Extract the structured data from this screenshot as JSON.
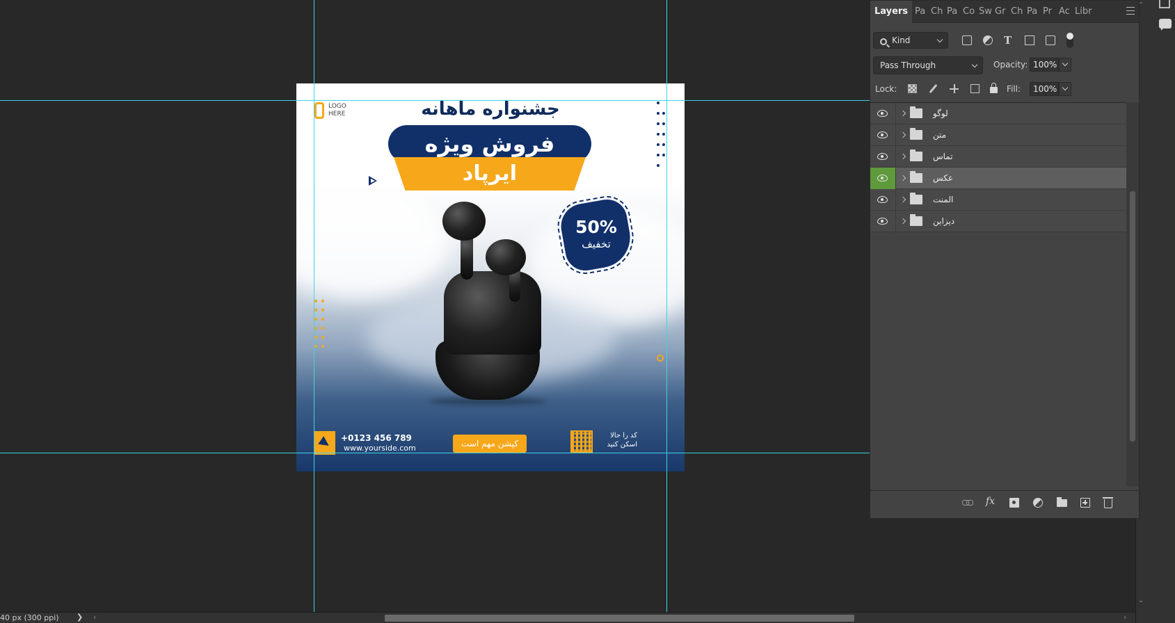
{
  "canvas": {
    "design": {
      "title_top": "جشنواره ماهانه",
      "banner_main": "فروش ویژه",
      "banner_product": "ایرپاد",
      "logo_text": "LOGO\nHERE",
      "discount_percent": "50%",
      "discount_label": "تخفیف",
      "phone": "+0123 456 789",
      "website": "www.yourside.com",
      "cta": "کپشن مهم است",
      "scan_line1": "کد را حالا",
      "scan_line2": "اسکن کنید",
      "colors": {
        "navy": "#11306a",
        "accent": "#f6a71a"
      }
    }
  },
  "status_bar": {
    "doc_info": "40 px (300 ppi)",
    "arrow": "❯"
  },
  "layers_panel": {
    "tabs": [
      {
        "label": "Layers",
        "active": true
      },
      {
        "label": "Pa"
      },
      {
        "label": "Ch"
      },
      {
        "label": "Pa"
      },
      {
        "label": "Co"
      },
      {
        "label": "Sw"
      },
      {
        "label": "Gr"
      },
      {
        "label": "Ch"
      },
      {
        "label": "Pa"
      },
      {
        "label": "Pr"
      },
      {
        "label": "Ac"
      },
      {
        "label": "Libr"
      }
    ],
    "filter": {
      "kind_label": "Kind"
    },
    "blend_mode": "Pass Through",
    "opacity_label": "Opacity:",
    "opacity_value": "100%",
    "lock_label": "Lock:",
    "fill_label": "Fill:",
    "fill_value": "100%",
    "layers": [
      {
        "name": "لوگو",
        "selected": false
      },
      {
        "name": "متن",
        "selected": false
      },
      {
        "name": "تماس",
        "selected": false
      },
      {
        "name": "عکس",
        "selected": true
      },
      {
        "name": "المنت",
        "selected": false
      },
      {
        "name": "دیزاین",
        "selected": false
      }
    ],
    "bottom_icons": [
      "link-icon",
      "fx-icon",
      "mask-icon",
      "adjustment-icon",
      "folder-icon",
      "new-layer-icon",
      "trash-icon"
    ],
    "fx_label": "fx"
  }
}
